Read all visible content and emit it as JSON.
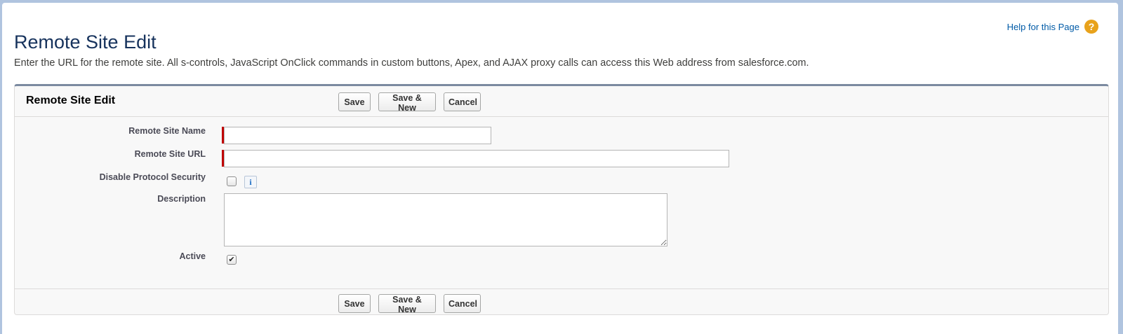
{
  "header": {
    "title": "Remote Site Edit",
    "help_link": "Help for this Page",
    "help_icon": "question-circle-icon"
  },
  "intro_text": "Enter the URL for the remote site. All s-controls, JavaScript OnClick commands in custom buttons, Apex, and AJAX proxy calls can access this Web address from salesforce.com.",
  "block": {
    "title": "Remote Site Edit",
    "buttons": {
      "save": "Save",
      "save_new": "Save & New",
      "cancel": "Cancel"
    }
  },
  "fields": {
    "remote_site_name": {
      "label": "Remote Site Name",
      "value": "",
      "required": true
    },
    "remote_site_url": {
      "label": "Remote Site URL",
      "value": "",
      "required": true
    },
    "disable_protocol_security": {
      "label": "Disable Protocol Security",
      "checked": false,
      "info_icon": "info-icon"
    },
    "description": {
      "label": "Description",
      "value": ""
    },
    "active": {
      "label": "Active",
      "checked": true
    }
  },
  "colors": {
    "title": "#16325c",
    "link": "#015ba7",
    "help_icon": "#e8a21b",
    "required": "#c00000",
    "block_top_border": "#7b8aa0"
  }
}
